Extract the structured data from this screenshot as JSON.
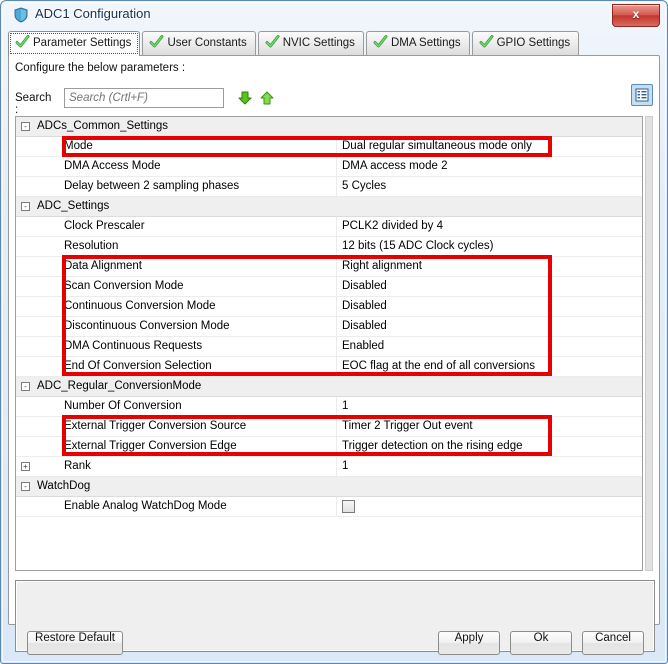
{
  "window": {
    "title": "ADC1 Configuration",
    "icon": "shield-icon",
    "close_label": "x"
  },
  "tabs": [
    {
      "label": "Parameter Settings",
      "icon": "green-check-icon",
      "active": true
    },
    {
      "label": "User Constants",
      "icon": "green-check-icon",
      "active": false
    },
    {
      "label": "NVIC Settings",
      "icon": "green-check-icon",
      "active": false
    },
    {
      "label": "DMA Settings",
      "icon": "green-check-icon",
      "active": false
    },
    {
      "label": "GPIO Settings",
      "icon": "green-check-icon",
      "active": false
    }
  ],
  "content": {
    "instruction": "Configure the below parameters :",
    "search": {
      "label": "Search :",
      "value": "",
      "placeholder": "Search (Crtl+F)",
      "down_icon": "green-arrow-down-icon",
      "up_icon": "green-arrow-up-icon"
    },
    "view_toggle_icon": "list-view-icon"
  },
  "tree": {
    "rows": [
      {
        "kind": "group",
        "expander": "-",
        "name": "ADCs_Common_Settings",
        "value": ""
      },
      {
        "kind": "leaf",
        "name": "Mode",
        "value": "Dual regular simultaneous mode only"
      },
      {
        "kind": "leaf",
        "name": "DMA Access Mode",
        "value": "DMA access mode 2"
      },
      {
        "kind": "leaf",
        "name": "Delay between 2 sampling phases",
        "value": "5 Cycles"
      },
      {
        "kind": "group",
        "expander": "-",
        "name": "ADC_Settings",
        "value": ""
      },
      {
        "kind": "leaf",
        "name": "Clock Prescaler",
        "value": "PCLK2 divided by 4"
      },
      {
        "kind": "leaf",
        "name": "Resolution",
        "value": "12 bits (15 ADC Clock cycles)"
      },
      {
        "kind": "leaf",
        "name": "Data Alignment",
        "value": "Right alignment"
      },
      {
        "kind": "leaf",
        "name": "Scan Conversion Mode",
        "value": "Disabled"
      },
      {
        "kind": "leaf",
        "name": "Continuous Conversion Mode",
        "value": "Disabled"
      },
      {
        "kind": "leaf",
        "name": "Discontinuous Conversion Mode",
        "value": "Disabled"
      },
      {
        "kind": "leaf",
        "name": "DMA Continuous Requests",
        "value": "Enabled"
      },
      {
        "kind": "leaf",
        "name": "End Of Conversion Selection",
        "value": "EOC flag at the end of all conversions"
      },
      {
        "kind": "group",
        "expander": "-",
        "name": "ADC_Regular_ConversionMode",
        "value": ""
      },
      {
        "kind": "leaf",
        "name": "Number Of Conversion",
        "value": "1"
      },
      {
        "kind": "leaf",
        "name": "External Trigger Conversion Source",
        "value": "Timer 2 Trigger Out event"
      },
      {
        "kind": "leaf",
        "name": "External Trigger Conversion Edge",
        "value": "Trigger detection on the rising edge"
      },
      {
        "kind": "leaf",
        "expander": "+",
        "name": "Rank",
        "value": "1"
      },
      {
        "kind": "group",
        "expander": "-",
        "name": "WatchDog",
        "value": ""
      },
      {
        "kind": "checkbox",
        "name": "Enable Analog WatchDog Mode",
        "value": "",
        "checked": false
      }
    ]
  },
  "annotations": {
    "highlight_color": "#e60000",
    "boxes": [
      {
        "label": "mode-highlight",
        "rows": [
          "Mode"
        ]
      },
      {
        "label": "adc-settings-highlight",
        "rows": [
          "Data Alignment",
          "Scan Conversion Mode",
          "Continuous Conversion Mode",
          "Discontinuous Conversion Mode",
          "DMA Continuous Requests",
          "End Of Conversion Selection"
        ]
      },
      {
        "label": "external-trigger-highlight",
        "rows": [
          "External Trigger Conversion Source",
          "External Trigger Conversion Edge"
        ]
      }
    ]
  },
  "footer": {
    "restore_default": "Restore Default",
    "apply": "Apply",
    "ok": "Ok",
    "cancel": "Cancel"
  }
}
